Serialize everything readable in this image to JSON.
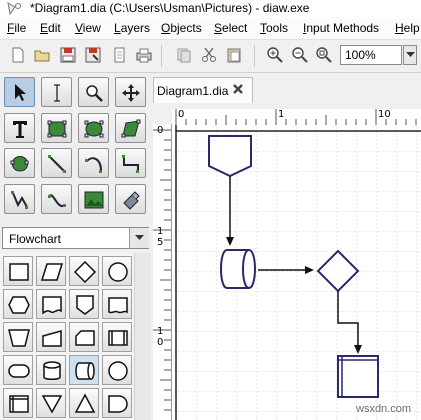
{
  "window": {
    "title": "*Diagram1.dia (C:\\Users\\Usman\\Pictures) - diaw.exe"
  },
  "menu": [
    "File",
    "Edit",
    "View",
    "Layers",
    "Objects",
    "Select",
    "Tools",
    "Input Methods",
    "Help"
  ],
  "toolbar": {
    "zoom_value": "100%",
    "icons": [
      "new-icon",
      "open-icon",
      "save-icon",
      "save-as-icon",
      "print-preview-icon",
      "print-icon",
      "copy-icon",
      "cut-icon",
      "paste-icon",
      "zoom-in-icon",
      "zoom-out-icon",
      "zoom-fit-icon"
    ]
  },
  "toolbox": {
    "tools": [
      "pointer-tool-icon",
      "text-edit-tool-icon",
      "magnify-tool-icon",
      "scroll-tool-icon",
      "text-tool-icon",
      "box-tool-icon",
      "ellipse-tool-icon",
      "polygon-tool-icon",
      "beziergon-tool-icon",
      "line-tool-icon",
      "arc-tool-icon",
      "zigzag-line-tool-icon",
      "polyline-tool-icon",
      "bezier-line-tool-icon",
      "image-tool-icon",
      "outline-tool-icon"
    ],
    "sheet_selector": "Flowchart",
    "shapes": [
      "process-shape-icon",
      "parallelogram-shape-icon",
      "decision-shape-icon",
      "connector-shape-icon",
      "preparation-shape-icon",
      "document-shape-icon",
      "offpage-connector-shape-icon",
      "punched-card-shape-icon",
      "manual-operation-shape-icon",
      "manual-input-shape-icon",
      "predefined-process-shape-icon",
      "terminal-shape-icon",
      "magnetic-disk-shape-icon",
      "direct-access-storage-shape-icon",
      "summing-junction-shape-icon",
      "internal-storage-shape-icon",
      "merge-shape-icon",
      "extract-shape-icon",
      "delay-shape-icon"
    ]
  },
  "tab": {
    "label": "Diagram1.dia"
  },
  "rulers": {
    "h_labels": [
      "0",
      "1",
      "10"
    ],
    "v_labels": [
      "0",
      "1",
      "5",
      "1",
      "0"
    ]
  },
  "watermark": "wsxdn.com"
}
